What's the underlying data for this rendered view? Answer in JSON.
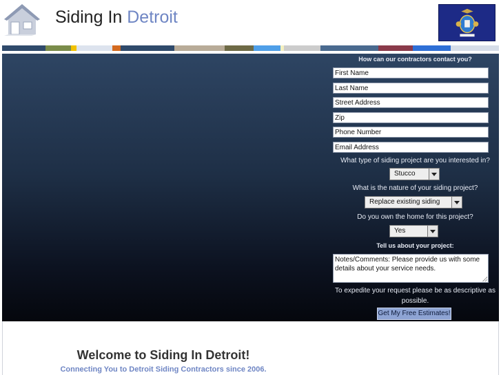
{
  "header": {
    "title_main": "Siding In ",
    "title_accent": "Detroit"
  },
  "stripe_colors": [
    "#2f4a6b",
    "#7a8c4a",
    "#f2c200",
    "#dde3ee",
    "#d46a1f",
    "#2f4a6b",
    "#b8ab98",
    "#6e6a46",
    "#4f9fe8",
    "#f4f0c0",
    "#cccccc",
    "#4a6a8f",
    "#8a3a4a",
    "#2e6fd6",
    "#d6dde8"
  ],
  "form": {
    "title": "How can our contractors contact you?",
    "fields": {
      "first_name": "First Name",
      "last_name": "Last Name",
      "street": "Street Address",
      "zip": "Zip",
      "phone": "Phone Number",
      "email": "Email Address"
    },
    "q_type": "What type of siding project are you interested in?",
    "type_value": "Stucco",
    "q_nature": "What is the nature of your siding project?",
    "nature_value": "Replace existing siding",
    "q_own": "Do you own the home for this project?",
    "own_value": "Yes",
    "q_tell": "Tell us about your project:",
    "notes": "Notes/Comments: Please provide us with some details about your service needs.",
    "expedite": "To expedite your request please be as descriptive as possible.",
    "submit": "Get My Free Estimates!"
  },
  "content": {
    "welcome": "Welcome to Siding In Detroit!",
    "tagline": "Connecting You to Detroit Siding Contractors since 2006."
  },
  "colors": {
    "accent": "#6f86c4",
    "hero_top": "#2e4563",
    "hero_bottom": "#05070d"
  }
}
